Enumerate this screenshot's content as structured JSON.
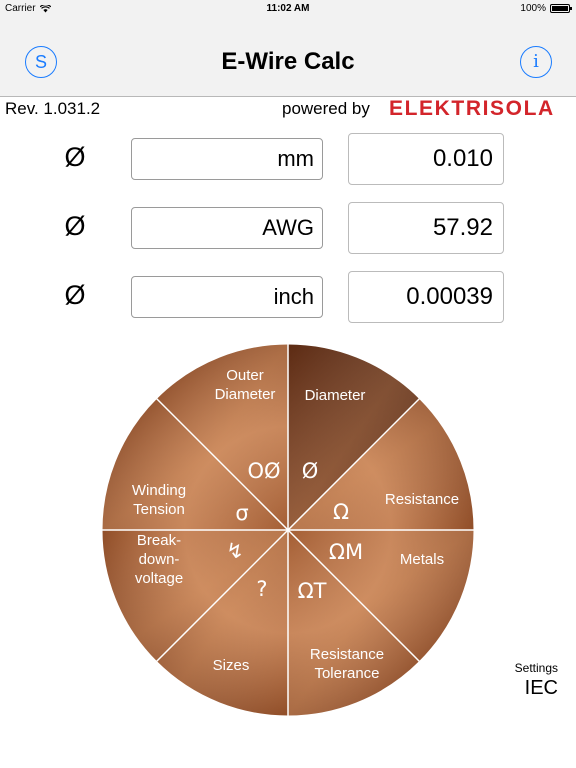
{
  "status_bar": {
    "carrier": "Carrier",
    "time": "11:02 AM",
    "battery": "100%"
  },
  "nav": {
    "title": "E-Wire Calc",
    "left_button": "S",
    "right_button": "i"
  },
  "info": {
    "revision": "Rev. 1.031.2",
    "powered_by": "powered by",
    "brand": "ELEKTRISOLA"
  },
  "rows": [
    {
      "symbol": "Ø",
      "unit": "mm",
      "value": "0.010"
    },
    {
      "symbol": "Ø",
      "unit": "AWG",
      "value": "57.92"
    },
    {
      "symbol": "Ø",
      "unit": "inch",
      "value": "0.00039"
    }
  ],
  "wheel": {
    "segments": [
      {
        "label": [
          "Diameter"
        ],
        "symbol": "Ø"
      },
      {
        "label": [
          "Resistance"
        ],
        "symbol": "Ω"
      },
      {
        "label": [
          "Metals"
        ],
        "symbol": "ΩM"
      },
      {
        "label": [
          "Resistance",
          "Tolerance"
        ],
        "symbol": "ΩT"
      },
      {
        "label": [
          "Sizes"
        ],
        "symbol": "?"
      },
      {
        "label": [
          "Break-",
          "down-",
          "voltage"
        ],
        "symbol": "↯"
      },
      {
        "label": [
          "Winding",
          "Tension"
        ],
        "symbol": "σ"
      },
      {
        "label": [
          "Outer",
          "Diameter"
        ],
        "symbol": "OØ"
      }
    ]
  },
  "settings": {
    "label": "Settings",
    "value": "IEC"
  },
  "colors": {
    "accent": "#1a7cff",
    "brand": "#d3252b",
    "copper_light": "#c98556",
    "copper_dark": "#6e3518"
  }
}
